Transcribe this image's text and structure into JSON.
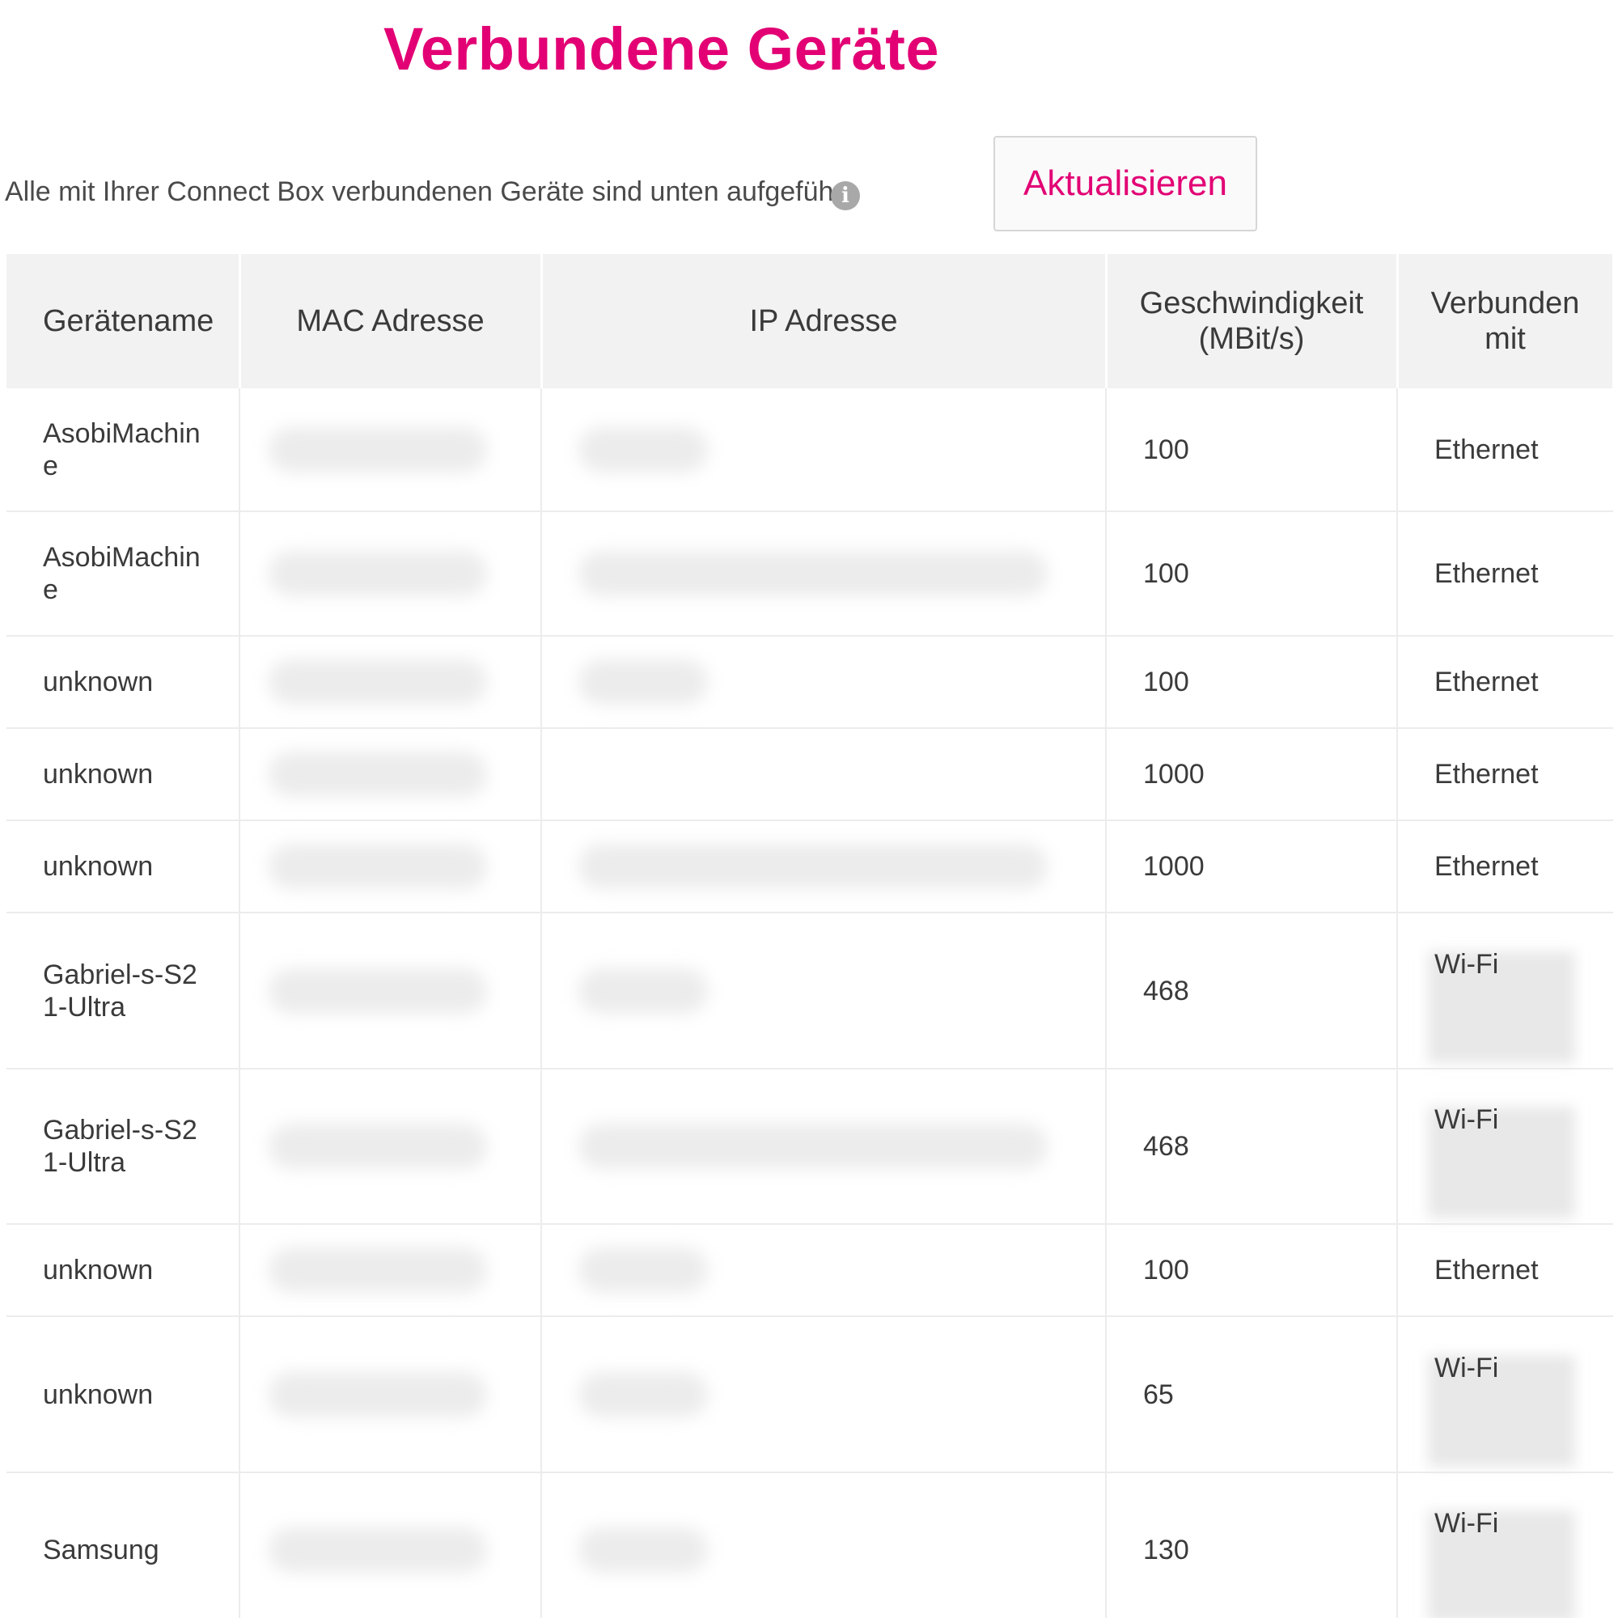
{
  "page": {
    "title": "Verbundene Geräte",
    "intro": "Alle mit Ihrer Connect Box verbundenen Geräte sind unten aufgeführt:",
    "info_icon": "i",
    "refresh_label": "Aktualisieren"
  },
  "colors": {
    "accent": "#e20074",
    "header_bg": "#f2f2f2",
    "text": "#3a3a3a"
  },
  "table": {
    "headers": {
      "name": "Gerätename",
      "mac": "MAC Adresse",
      "ip": "IP Adresse",
      "speed_line1": "Geschwindigkeit",
      "speed_line2": "(MBit/s)",
      "connected_line1": "Verbunden",
      "connected_line2": "mit"
    },
    "rows": [
      {
        "name": "AsobiMachine",
        "speed": "100",
        "connected": "Ethernet"
      },
      {
        "name": "AsobiMachine",
        "speed": "100",
        "connected": "Ethernet"
      },
      {
        "name": "unknown",
        "speed": "100",
        "connected": "Ethernet"
      },
      {
        "name": "unknown",
        "speed": "1000",
        "connected": "Ethernet"
      },
      {
        "name": "unknown",
        "speed": "1000",
        "connected": "Ethernet"
      },
      {
        "name": "Gabriel-s-S21-Ultra",
        "speed": "468",
        "connected": "Wi-Fi"
      },
      {
        "name": "Gabriel-s-S21-Ultra",
        "speed": "468",
        "connected": "Wi-Fi"
      },
      {
        "name": "unknown",
        "speed": "100",
        "connected": "Ethernet"
      },
      {
        "name": "unknown",
        "speed": "65",
        "connected": "Wi-Fi"
      },
      {
        "name": "Samsung",
        "speed": "130",
        "connected": "Wi-Fi"
      }
    ]
  }
}
